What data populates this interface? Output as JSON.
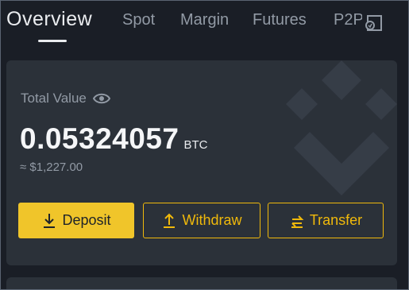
{
  "tabs": [
    {
      "label": "Overview",
      "active": true
    },
    {
      "label": "Spot",
      "active": false
    },
    {
      "label": "Margin",
      "active": false
    },
    {
      "label": "Futures",
      "active": false
    },
    {
      "label": "P2P",
      "active": false
    }
  ],
  "card": {
    "total_label": "Total Value",
    "balance_value": "0.05324057",
    "balance_unit": "BTC",
    "fiat_value": "≈ $1,227.00"
  },
  "actions": {
    "deposit": "Deposit",
    "withdraw": "Withdraw",
    "transfer": "Transfer"
  },
  "colors": {
    "accent": "#f0b90b",
    "background": "#1a1e26",
    "card": "#2b3139"
  },
  "icons": {
    "p2p": "p2p-icon",
    "eye": "eye-icon",
    "deposit": "download-icon",
    "withdraw": "upload-icon",
    "transfer": "transfer-icon",
    "watermark": "exchange-logo-watermark"
  }
}
